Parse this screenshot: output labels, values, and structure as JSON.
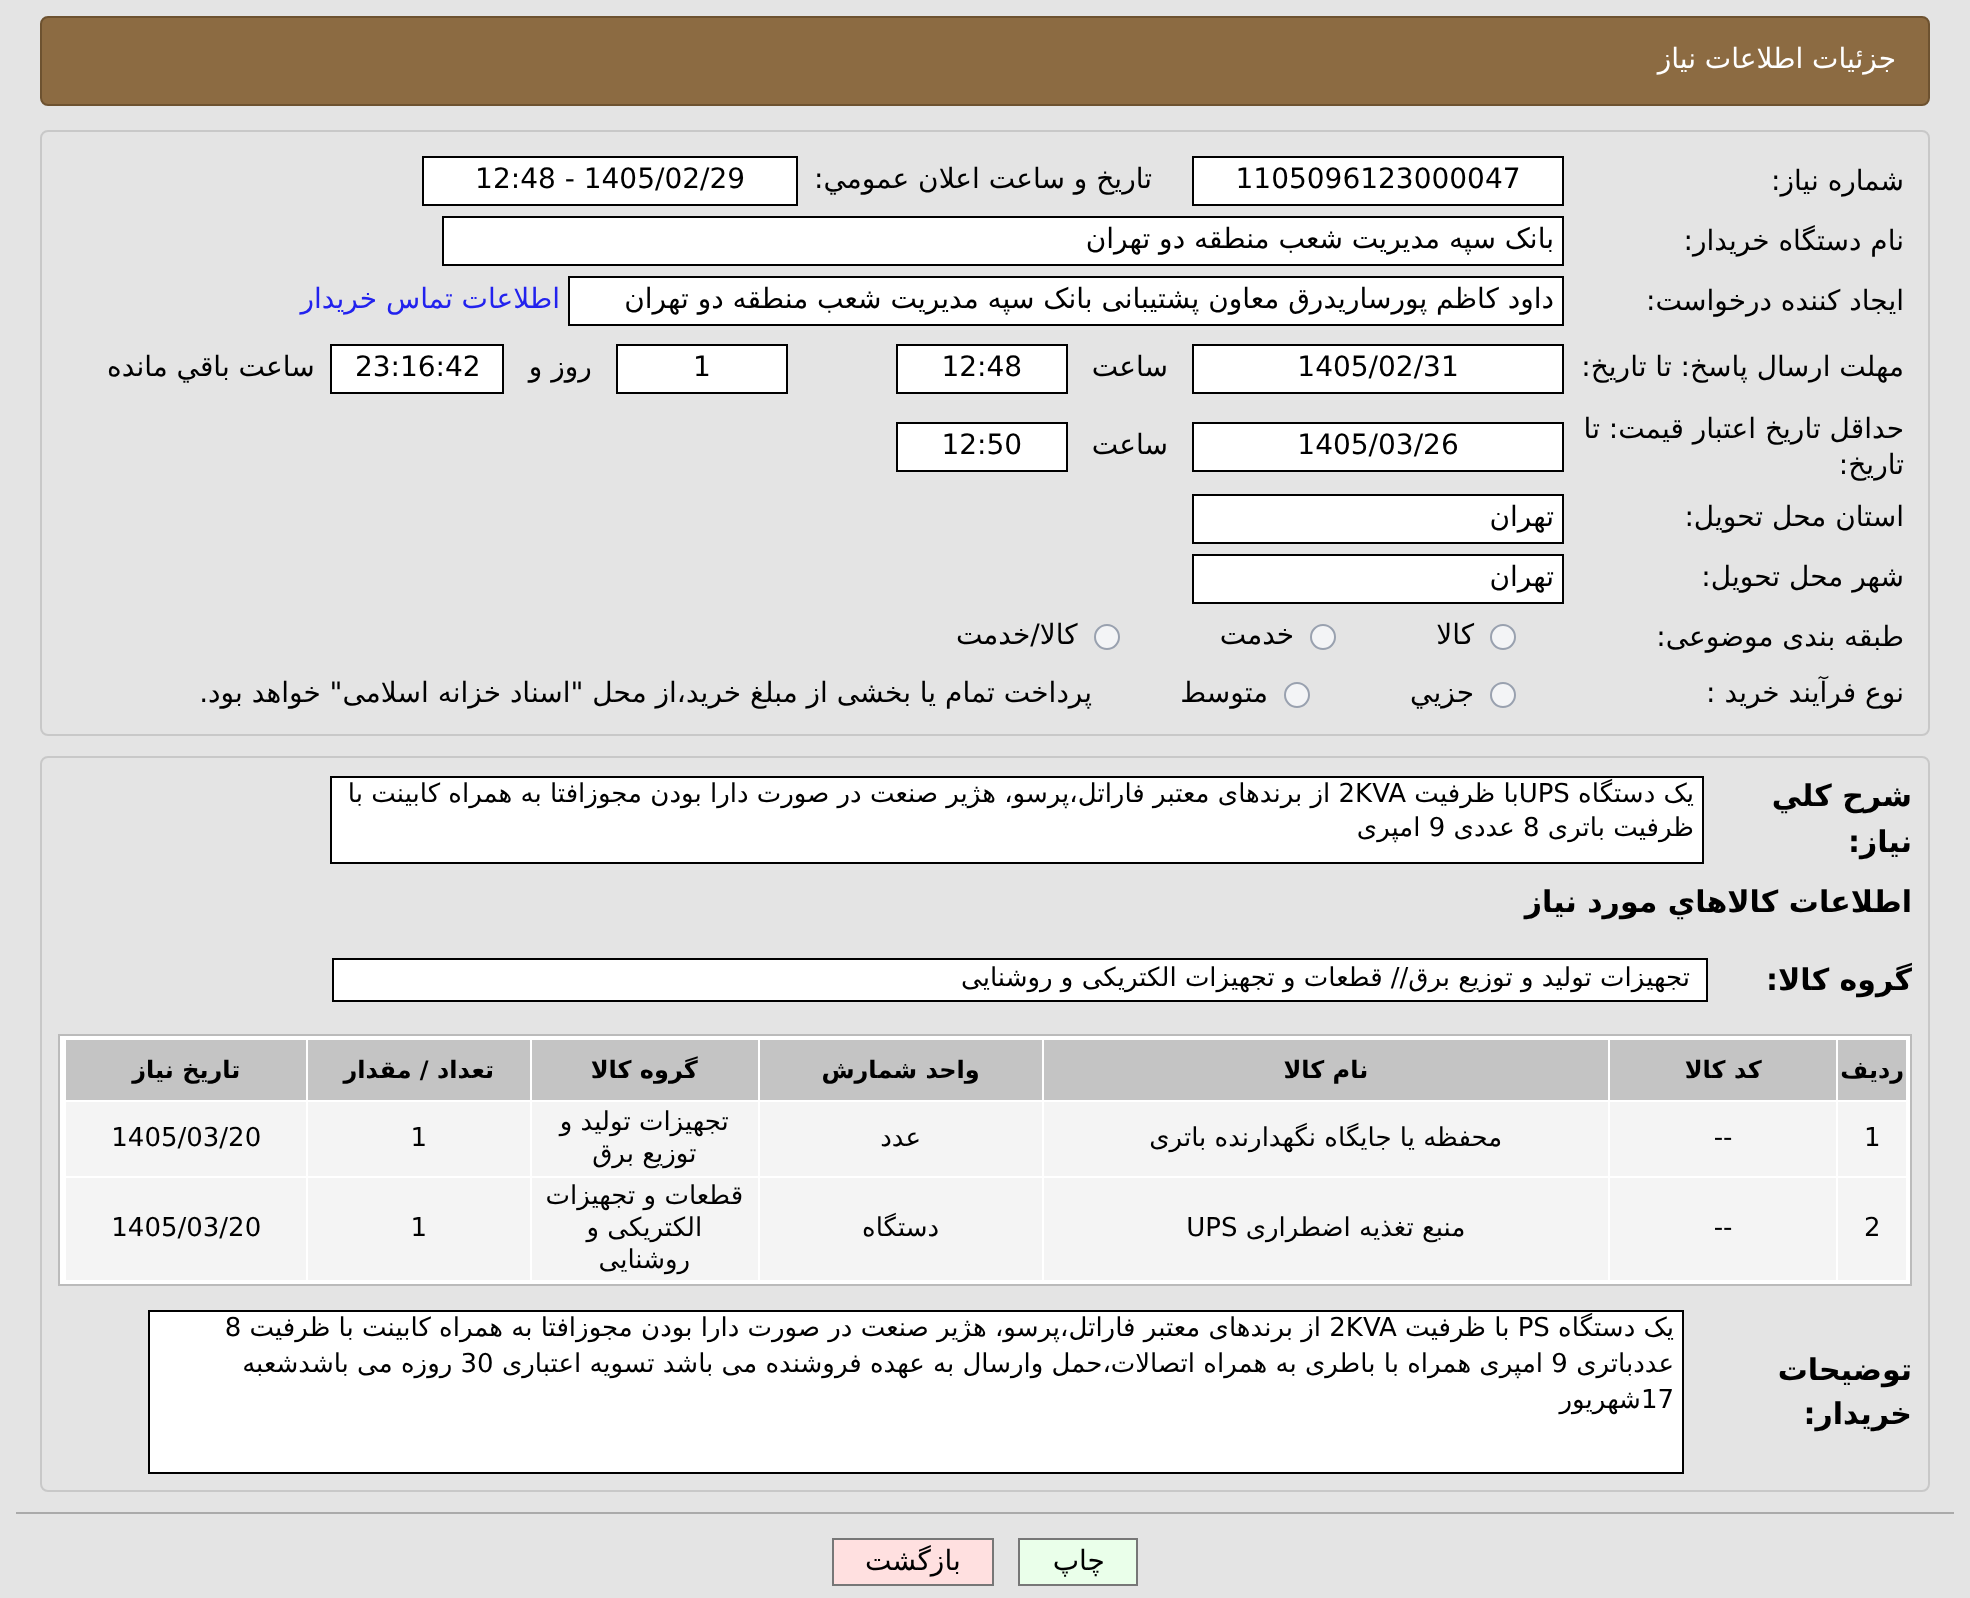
{
  "header": {
    "title": "جزئیات اطلاعات نیاز"
  },
  "need_number": {
    "label": "شماره نیاز:",
    "value": "1105096123000047"
  },
  "announce": {
    "label": "تاریخ و ساعت اعلان عمومي:",
    "value": "1405/02/29 - 12:48"
  },
  "buyer_org": {
    "label": "نام دستگاه خریدار:",
    "value": "بانک سپه مدیریت شعب منطقه دو تهران"
  },
  "requester": {
    "label": "ایجاد کننده درخواست:",
    "value": "داود کاظم پورساریدرق معاون پشتیبانی بانک سپه مدیریت شعب منطقه دو تهران",
    "link": "اطلاعات تماس خریدار"
  },
  "deadline": {
    "label": "مهلت ارسال پاسخ: تا تاریخ:",
    "date": "1405/02/31",
    "time_label": "ساعت",
    "time": "12:48",
    "days": "1",
    "days_label": "روز و",
    "remaining": "23:16:42",
    "remaining_label": "ساعت باقي مانده"
  },
  "validity": {
    "label": "حداقل تاریخ اعتبار قیمت: تا تاریخ:",
    "date": "1405/03/26",
    "time_label": "ساعت",
    "time": "12:50"
  },
  "province": {
    "label": "استان محل تحویل:",
    "value": "تهران"
  },
  "city": {
    "label": "شهر محل تحویل:",
    "value": "تهران"
  },
  "category": {
    "label": "طبقه بندی موضوعی:",
    "options": [
      {
        "label": "کالا",
        "selected": false
      },
      {
        "label": "خدمت",
        "selected": false
      },
      {
        "label": "کالا/خدمت",
        "selected": false
      }
    ]
  },
  "process": {
    "label": "نوع فرآیند خرید :",
    "options": [
      {
        "label": "جزيي",
        "selected": false
      },
      {
        "label": "متوسط",
        "selected": false
      }
    ],
    "note": "پرداخت تمام یا بخشی از مبلغ خرید،از محل \"اسناد خزانه اسلامی\" خواهد بود."
  },
  "description": {
    "label": "شرح کلي نیاز:",
    "value": "یک دستگاه UPSبا ظرفیت 2KVA از برندهای معتبر فاراتل،پرسو، هژیر صنعت در صورت دارا بودن مجوزافتا به همراه کابینت با ظرفیت باتری 8 عددی 9 امپری"
  },
  "goods_heading": "اطلاعات کالاهاي مورد نیاز",
  "goods_group": {
    "label": "گروه کالا:",
    "value": "تجهیزات تولید و توزیع برق// قطعات و تجهیزات الکتریکی و روشنایی"
  },
  "table": {
    "columns": [
      "ردیف",
      "کد کالا",
      "نام کالا",
      "واحد شمارش",
      "گروه کالا",
      "تعداد / مقدار",
      "تاریخ نیاز"
    ],
    "rows": [
      [
        "1",
        "--",
        "محفظه یا جایگاه نگهدارنده باتری",
        "عدد",
        "تجهیزات تولید و توزیع برق",
        "1",
        "1405/03/20"
      ],
      [
        "2",
        "--",
        "منبع تغذیه اضطراری UPS",
        "دستگاه",
        "قطعات و تجهیزات الکتریکی و روشنایی",
        "1",
        "1405/03/20"
      ]
    ]
  },
  "buyer_notes": {
    "label": "توضیحات خریدار:",
    "value": "یک دستگاه PS با ظرفیت 2KVA از برندهای معتبر فاراتل،پرسو، هژیر صنعت در صورت دارا بودن مجوزافتا به همراه کابینت با ظرفیت  8 عددباتری 9 امپری همراه با باطری به همراه اتصالات،حمل وارسال به عهده فروشنده می باشد تسویه اعتباری 30 روزه می باشدشعبه 17شهریور"
  },
  "buttons": [
    {
      "label": "چاپ",
      "kind": "print"
    },
    {
      "label": "بازگشت",
      "kind": "back"
    }
  ]
}
